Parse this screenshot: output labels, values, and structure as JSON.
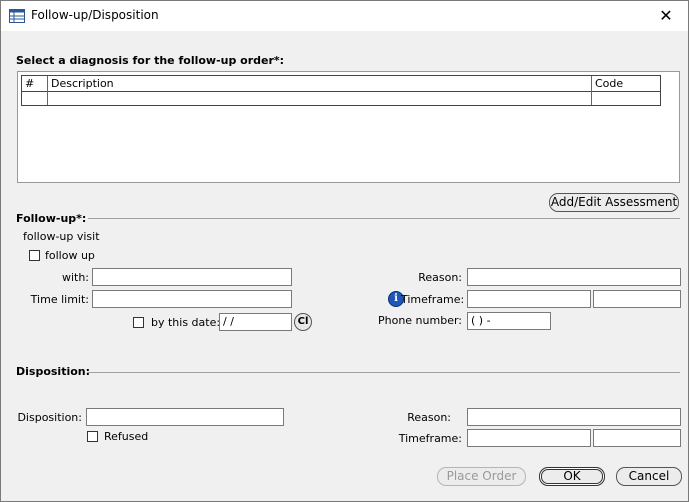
{
  "window": {
    "title": "Follow-up/Disposition",
    "close_glyph": "✕"
  },
  "diagnosis": {
    "label": "Select a diagnosis for the follow-up order*:",
    "columns": [
      "#",
      "Description",
      "Code"
    ]
  },
  "add_edit_button": "Add/Edit Assessment",
  "followup": {
    "section_label": "Follow-up*:",
    "visit_label": "follow-up visit",
    "follow_up_checkbox": "follow up",
    "with_label": "with:",
    "time_limit_label": "Time limit:",
    "by_this_date_label": "by this date:",
    "date_value": "  /  /",
    "calendar_glyph": "Cl",
    "reason_label": "Reason:",
    "timeframe_label": "Timeframe:",
    "info_glyph": "i",
    "phone_label": "Phone number:",
    "phone_value": "(   )    -"
  },
  "disposition": {
    "section_label": "Disposition:",
    "disposition_label": "Disposition:",
    "refused_label": "Refused",
    "reason_label": "Reason:",
    "timeframe_label": "Timeframe:"
  },
  "footer": {
    "place_order": "Place Order",
    "ok": "OK",
    "cancel": "Cancel"
  }
}
